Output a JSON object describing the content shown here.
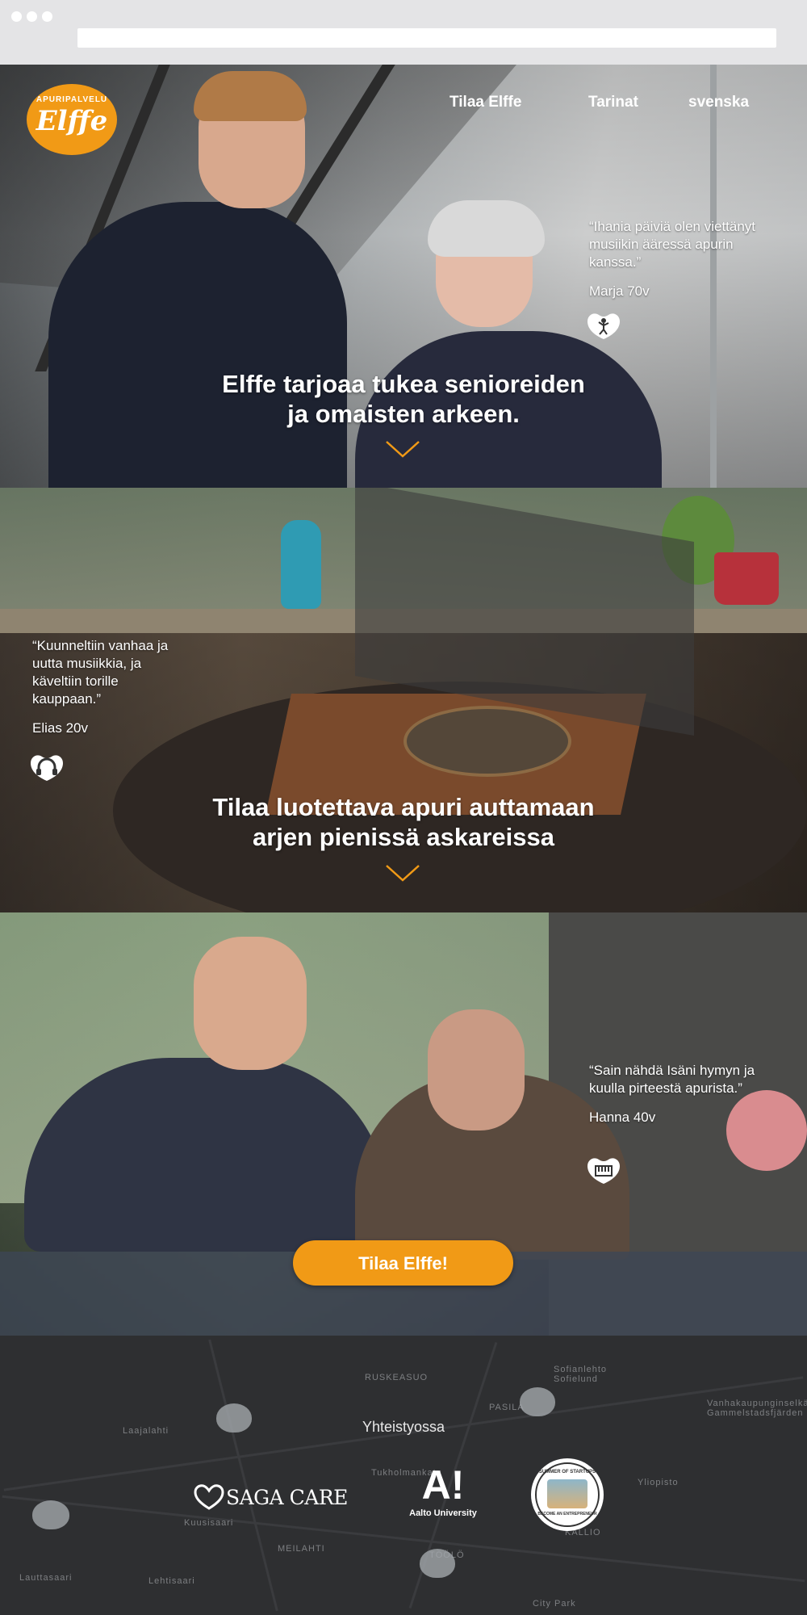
{
  "nav": {
    "logo_small": "APURIPALVELU",
    "logo_big": "Elffe",
    "links": [
      "Tilaa Elffe",
      "Tarinat",
      "svenska"
    ]
  },
  "sections": [
    {
      "headline_lines": [
        "Elffe tarjoaa tukea senioreiden",
        "ja omaisten arkeen."
      ],
      "quote": "“Ihania päiviä olen viettänyt musiikin ääressä apurin kanssa.”",
      "author": "Marja 70v",
      "icon": "dancing-person-icon"
    },
    {
      "headline_lines": [
        "Tilaa luotettava apuri auttamaan",
        "arjen pienissä askareissa"
      ],
      "quote": "“Kuunneltiin vanhaa ja uutta musiikkia, ja käveltiin torille kauppaan.”",
      "author": "Elias 20v",
      "icon": "headphones-icon"
    },
    {
      "quote": "“Sain nähdä Isäni hymyn ja kuulla pirteestä apurista.”",
      "author": "Hanna 40v",
      "icon": "piano-icon"
    }
  ],
  "cta": {
    "label": "Tilaa Elffe!"
  },
  "partners": {
    "title": "Yhteistyossa",
    "items": [
      {
        "name": "SAGA CARE"
      },
      {
        "name": "A!",
        "subtitle": "Aalto University"
      },
      {
        "name": "SUMMER OF STARTUPS",
        "subtitle": "BECOME AN ENTREPRENEUR"
      }
    ]
  },
  "map_labels": [
    "RUSKEASUO",
    "PASILA",
    "Laajalahti",
    "Sofianlehto Sofielund",
    "Vanhakaupunginselkä Gammelstadsfjärden",
    "Tukholmankatu",
    "Kuusisaari",
    "MEILAHTI",
    "TÖÖLÖ",
    "KALLIO",
    "Lehtisaari",
    "Lauttasaari",
    "City Park",
    "Yliopisto"
  ],
  "colors": {
    "accent": "#f19a16",
    "footer_bg": "#2e2f31"
  }
}
